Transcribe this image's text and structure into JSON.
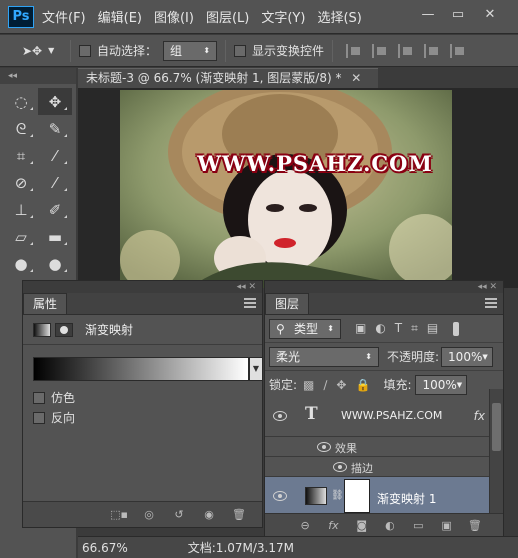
{
  "app": {
    "logo": "Ps"
  },
  "menu": [
    "文件(F)",
    "编辑(E)",
    "图像(I)",
    "图层(L)",
    "文字(Y)",
    "选择(S)"
  ],
  "window_controls": {
    "minimize": "—",
    "restore": "▭",
    "close": "✕"
  },
  "options": {
    "auto_select_label": "自动选择：",
    "auto_select_value": "组",
    "show_transform_label": "显示变换控件"
  },
  "document": {
    "tab_title": "未标题-3 @ 66.7% (渐变映射 1, 图层蒙版/8) *",
    "watermark": "WWW.PSAHZ.COM"
  },
  "properties": {
    "tab": "属性",
    "adjustment_name": "渐变映射",
    "dither_label": "仿色",
    "reverse_label": "反向"
  },
  "layers": {
    "tab": "图层",
    "filter_type": "类型",
    "blend_mode": "柔光",
    "opacity_label": "不透明度:",
    "opacity_value": "100%",
    "lock_label": "锁定:",
    "fill_label": "填充:",
    "fill_value": "100%",
    "text_layer_name": "WWW.PSAHZ.COM",
    "effects_label": "效果",
    "stroke_label": "描边",
    "gradient_map_layer": "渐变映射 1",
    "fx": "fx"
  },
  "status": {
    "zoom": "66.67%",
    "doc_info": "文档:1.07M/3.17M"
  },
  "colors": {
    "selected_layer": "#6c7a91",
    "accent": "#31a8ff",
    "stroke": "#8a0012"
  }
}
